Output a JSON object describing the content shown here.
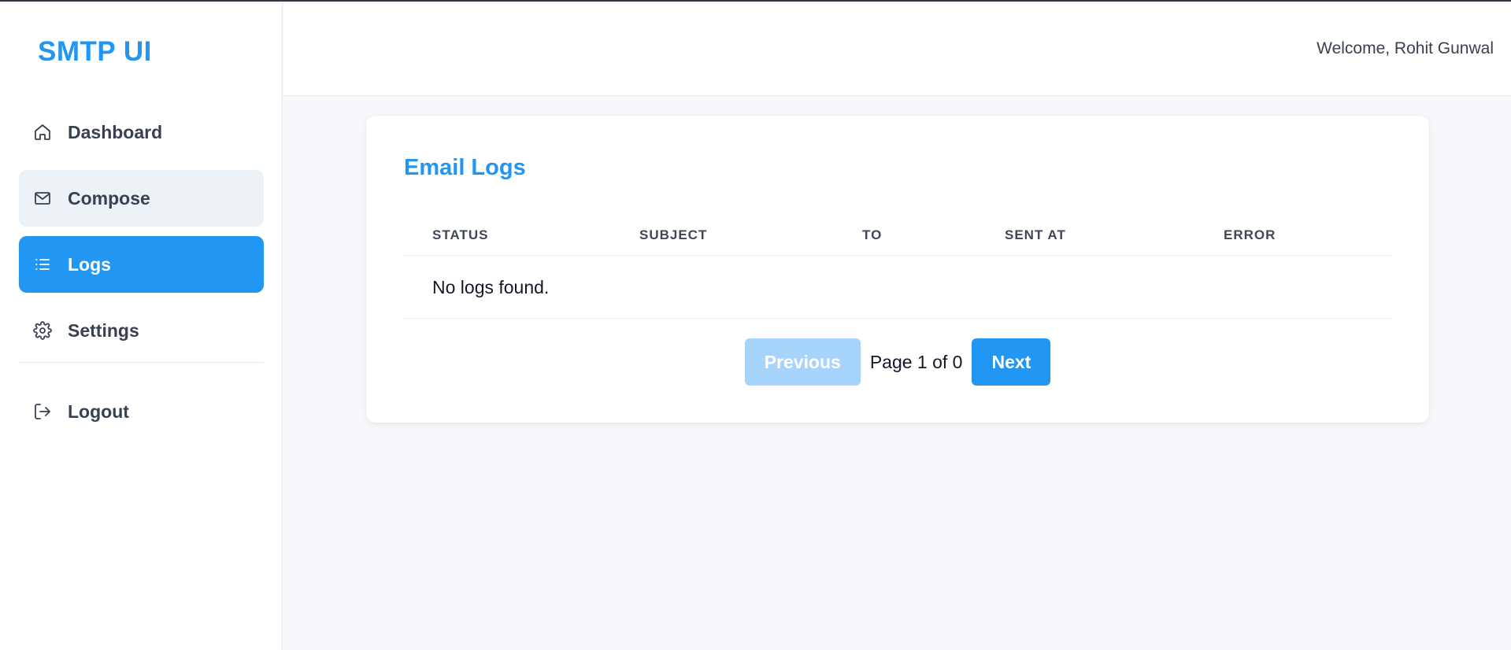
{
  "app": {
    "brand": "SMTP UI"
  },
  "sidebar": {
    "items": [
      {
        "label": "Dashboard",
        "icon": "home-icon"
      },
      {
        "label": "Compose",
        "icon": "mail-icon"
      },
      {
        "label": "Logs",
        "icon": "list-icon"
      },
      {
        "label": "Settings",
        "icon": "gear-icon"
      }
    ],
    "logout": {
      "label": "Logout",
      "icon": "logout-icon"
    },
    "active_item": "Logs"
  },
  "header": {
    "welcome": "Welcome, Rohit Gunwal"
  },
  "logs": {
    "title": "Email Logs",
    "columns": [
      "STATUS",
      "SUBJECT",
      "TO",
      "SENT AT",
      "ERROR"
    ],
    "empty_message": "No logs found.",
    "pagination": {
      "previous_label": "Previous",
      "page_info": "Page 1 of 0",
      "next_label": "Next"
    }
  },
  "colors": {
    "accent": "#2196f3",
    "accent_disabled": "#a6d4fa",
    "page_background": "#f6f8fb"
  }
}
